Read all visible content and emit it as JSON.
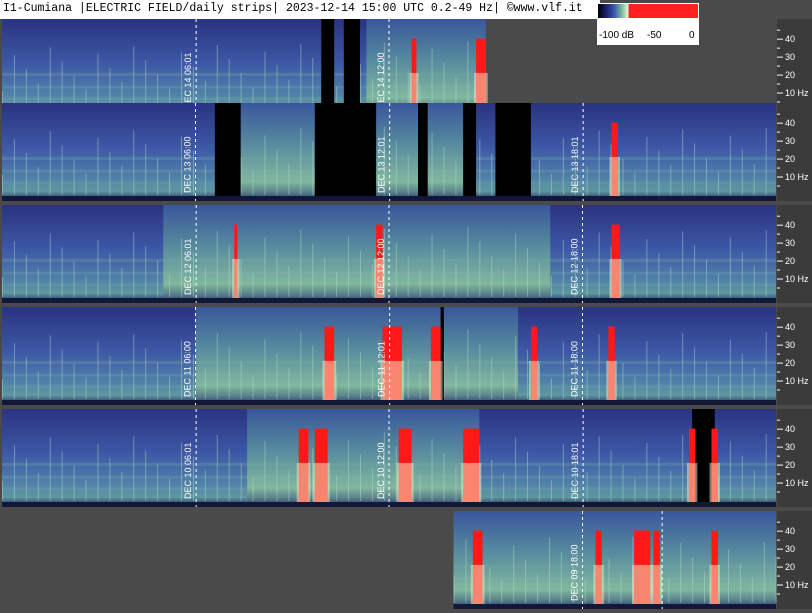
{
  "header": {
    "title": "I1-Cumiana |ELECTRIC FIELD/daily strips| 2023-12-14 15:00 UTC 0.2-49 Hz| ©www.vlf.it"
  },
  "legend": {
    "labels": [
      "-100 dB",
      "-50",
      "0"
    ],
    "colors": [
      "#000000",
      "#1b1f6a",
      "#3a55b0",
      "#7fbf9a",
      "#e8f2d8",
      "#ff2020"
    ]
  },
  "colors": {
    "background": "#4a4a4a",
    "low": "#2e3a8c",
    "mid": "#6faf8a",
    "high": "#ff1818",
    "no_data": "#000000"
  },
  "chart_data": {
    "type": "heatmap",
    "title": "I1-Cumiana |ELECTRIC FIELD/daily strips| 2023-12-14 15:00 UTC 0.2-49 Hz| ©www.vlf.it",
    "ylim_hz": [
      0,
      49
    ],
    "y_tick_labels": [
      "40",
      "30",
      "20",
      "10 Hz"
    ],
    "colorbar": {
      "min_db": -100,
      "max_db": 0,
      "labels": [
        "-100 dB",
        "-50",
        "0"
      ]
    },
    "strips": [
      {
        "date": "DEC 14",
        "coverage_hours": [
          0,
          15
        ],
        "markers": [
          {
            "hour": 6.02,
            "label": "DEC 14  06:01"
          },
          {
            "hour": 12.0,
            "label": "DEC 14  12:00"
          }
        ],
        "gaps_hours": [
          [
            9.9,
            10.3
          ],
          [
            10.6,
            11.1
          ]
        ],
        "bright_bands_hours": [
          [
            11.3,
            15.0
          ]
        ],
        "red_events_hours": [
          [
            12.7,
            0.15
          ],
          [
            14.7,
            0.3
          ]
        ]
      },
      {
        "date": "DEC 13",
        "coverage_hours": [
          0,
          24
        ],
        "markers": [
          {
            "hour": 6.0,
            "label": "DEC 13  06:00"
          },
          {
            "hour": 12.02,
            "label": "DEC 13  12:01"
          },
          {
            "hour": 18.02,
            "label": "DEC 13  18:01"
          }
        ],
        "gaps_hours": [
          [
            6.6,
            7.4
          ],
          [
            9.7,
            11.6
          ],
          [
            12.9,
            13.2
          ],
          [
            14.3,
            14.7
          ],
          [
            15.3,
            16.4
          ]
        ],
        "bright_bands_hours": [
          [
            7.4,
            9.7
          ],
          [
            11.6,
            14.3
          ]
        ],
        "red_events_hours": [
          [
            18.9,
            0.2
          ]
        ]
      },
      {
        "date": "DEC 12",
        "coverage_hours": [
          0,
          24
        ],
        "markers": [
          {
            "hour": 6.02,
            "label": "DEC 12  06:01"
          },
          {
            "hour": 12.0,
            "label": "DEC 12  12:00"
          },
          {
            "hour": 18.0,
            "label": "DEC 12  18:00"
          }
        ],
        "gaps_hours": [],
        "bright_bands_hours": [
          [
            5.0,
            17.0
          ]
        ],
        "red_events_hours": [
          [
            7.2,
            0.1
          ],
          [
            11.6,
            0.2
          ],
          [
            18.9,
            0.25
          ]
        ]
      },
      {
        "date": "DEC 11",
        "coverage_hours": [
          0,
          24
        ],
        "markers": [
          {
            "hour": 6.0,
            "label": "DEC 11  06:00"
          },
          {
            "hour": 12.02,
            "label": "DEC 11  12:01"
          },
          {
            "hour": 18.0,
            "label": "DEC 11  18:00"
          }
        ],
        "gaps_hours": [
          [
            13.6,
            13.7
          ]
        ],
        "bright_bands_hours": [
          [
            6.0,
            16.0
          ]
        ],
        "red_events_hours": [
          [
            10.0,
            0.3
          ],
          [
            11.8,
            0.6
          ],
          [
            13.3,
            0.3
          ],
          [
            16.4,
            0.2
          ],
          [
            18.8,
            0.2
          ]
        ]
      },
      {
        "date": "DEC 10",
        "coverage_hours": [
          0,
          24
        ],
        "markers": [
          {
            "hour": 6.02,
            "label": "DEC 10  06:01"
          },
          {
            "hour": 12.0,
            "label": "DEC 10  12:00"
          },
          {
            "hour": 18.02,
            "label": "DEC 10  18:01"
          }
        ],
        "gaps_hours": [
          [
            21.4,
            22.1
          ]
        ],
        "bright_bands_hours": [
          [
            7.6,
            14.8
          ]
        ],
        "red_events_hours": [
          [
            9.2,
            0.3
          ],
          [
            9.7,
            0.4
          ],
          [
            12.3,
            0.4
          ],
          [
            14.3,
            0.5
          ],
          [
            21.3,
            0.2
          ],
          [
            22.0,
            0.2
          ]
        ]
      },
      {
        "date": "DEC 09",
        "coverage_hours": [
          14,
          24
        ],
        "markers": [
          {
            "hour": 18.0,
            "label": "DEC 09  18:00"
          },
          {
            "hour": 20.47,
            "label": ""
          }
        ],
        "gaps_hours": [],
        "bright_bands_hours": [
          [
            14.0,
            24.0
          ]
        ],
        "red_events_hours": [
          [
            14.6,
            0.3
          ],
          [
            18.4,
            0.2
          ],
          [
            19.6,
            0.5
          ],
          [
            20.2,
            0.2
          ],
          [
            22.0,
            0.2
          ]
        ]
      }
    ]
  }
}
